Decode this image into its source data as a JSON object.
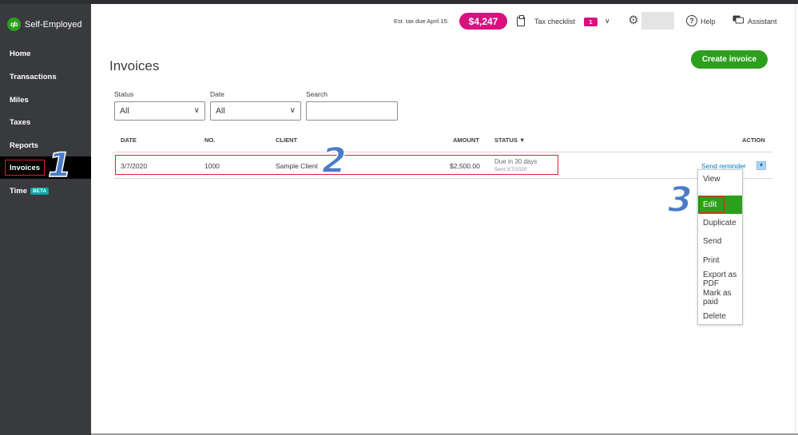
{
  "app": {
    "brand": "Self-Employed",
    "logo_text": "qb"
  },
  "sidebar": {
    "items": [
      {
        "label": "Home"
      },
      {
        "label": "Transactions"
      },
      {
        "label": "Miles"
      },
      {
        "label": "Taxes"
      },
      {
        "label": "Reports"
      },
      {
        "label": "Invoices"
      },
      {
        "label": "Time",
        "badge": "BETA"
      }
    ]
  },
  "header": {
    "est_tax_label": "Est. tax due April 15:",
    "est_tax_value": "$4,247",
    "tax_checklist_label": "Tax checklist",
    "tax_checklist_count": "1",
    "help_label": "Help",
    "assistant_label": "Assistant"
  },
  "page": {
    "title": "Invoices",
    "create_button": "Create invoice"
  },
  "filters": {
    "status_label": "Status",
    "status_value": "All",
    "date_label": "Date",
    "date_value": "All",
    "search_label": "Search"
  },
  "table": {
    "headers": {
      "date": "DATE",
      "no": "NO.",
      "client": "CLIENT",
      "amount": "AMOUNT",
      "status": "STATUS ▼",
      "action": "ACTION"
    },
    "rows": [
      {
        "date": "3/7/2020",
        "no": "1000",
        "client": "Sample Client",
        "amount": "$2,500.00",
        "status": "Due in 30 days",
        "status_sub": "Sent 3/7/2020",
        "action": "Send reminder"
      }
    ]
  },
  "action_menu": {
    "items": [
      "View",
      "Edit",
      "Duplicate",
      "Send",
      "Print",
      "Export as PDF",
      "Mark as paid",
      "Delete"
    ],
    "selected": "Edit"
  },
  "annotations": {
    "step1": "1",
    "step2": "2",
    "step3": "3"
  },
  "colors": {
    "accent_green": "#2ca01c",
    "tax_pink": "#d8117f",
    "sidebar_bg": "#393a3d",
    "link_blue": "#0077c5",
    "highlight_red": "#e02030"
  }
}
